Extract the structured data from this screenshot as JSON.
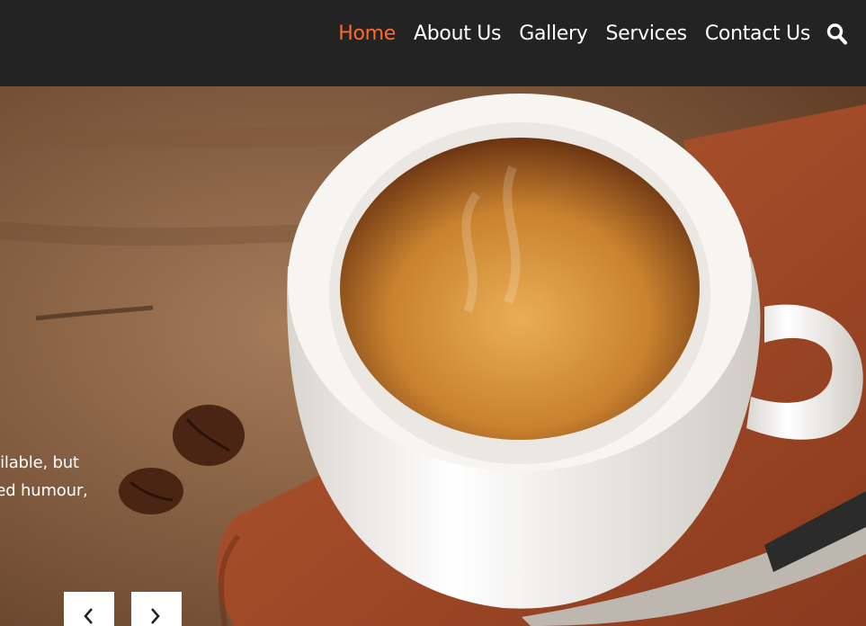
{
  "nav": {
    "items": [
      {
        "label": "Home",
        "active": true
      },
      {
        "label": "About Us",
        "active": false
      },
      {
        "label": "Gallery",
        "active": false
      },
      {
        "label": "Services",
        "active": false
      },
      {
        "label": "Contact Us",
        "active": false
      }
    ],
    "search_icon": "search-icon",
    "active_color": "#ff6a2b",
    "background_color": "#232323"
  },
  "hero": {
    "text_lines": [
      "available, but",
      "ected humour,"
    ],
    "prev_icon": "chevron-left-icon",
    "next_icon": "chevron-right-icon"
  }
}
